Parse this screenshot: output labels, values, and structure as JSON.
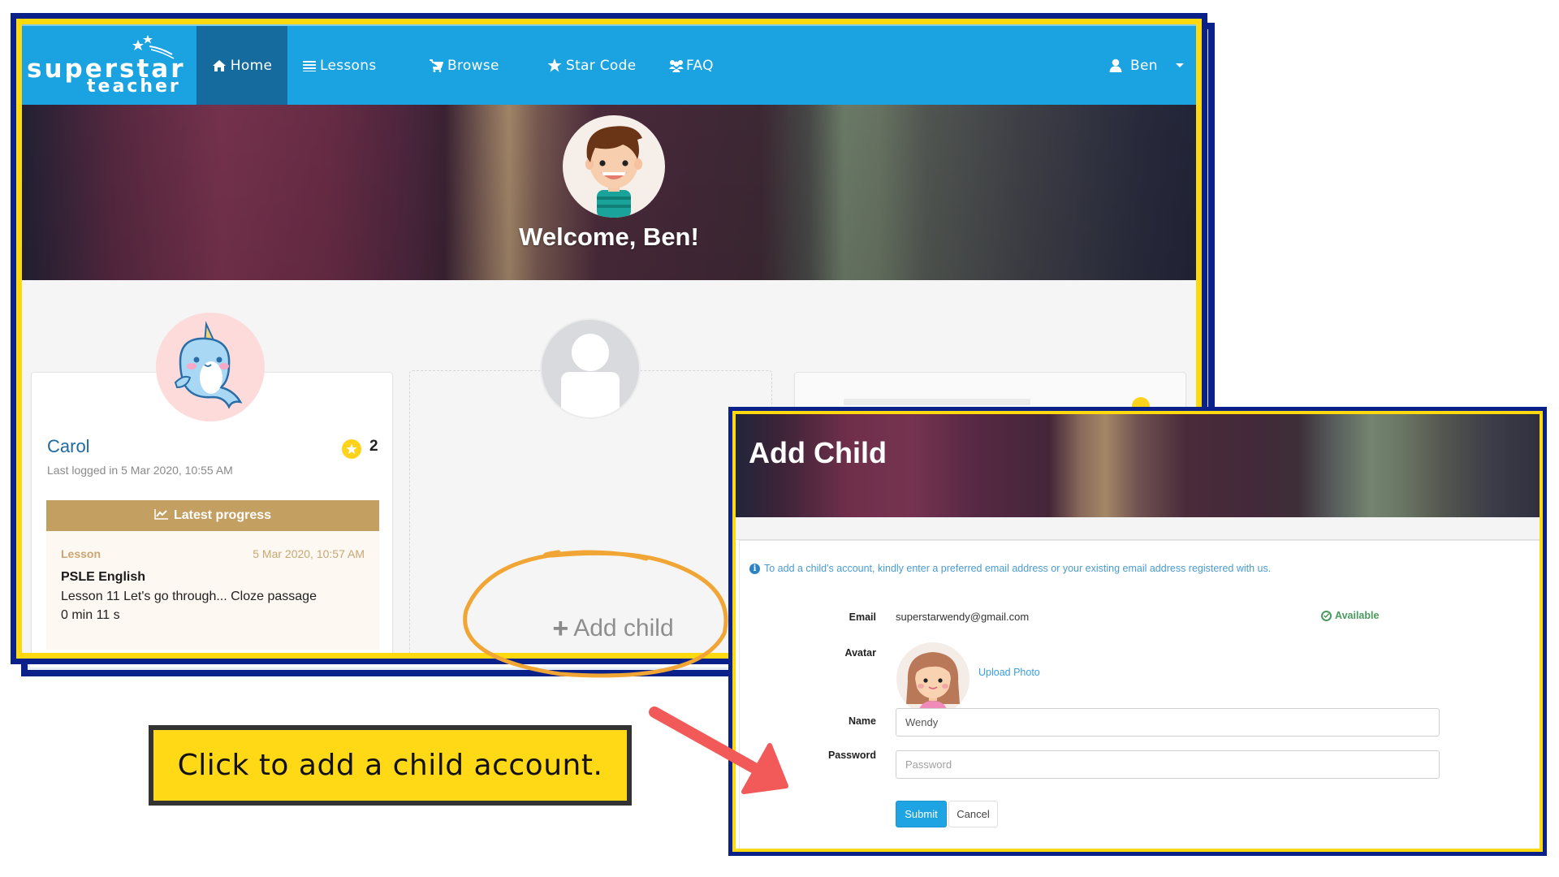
{
  "nav": {
    "logo_line1": "superstar",
    "logo_line2": "teacher",
    "items": [
      {
        "label": "Home",
        "icon": "home-icon",
        "active": true
      },
      {
        "label": "Lessons",
        "icon": "list-icon",
        "active": false
      },
      {
        "label": "Browse",
        "icon": "cart-icon",
        "active": false
      },
      {
        "label": "Star Code",
        "icon": "star-icon",
        "active": false
      },
      {
        "label": "FAQ",
        "icon": "users-icon",
        "active": false
      }
    ],
    "user": {
      "name": "Ben",
      "icon": "user-icon"
    }
  },
  "banner": {
    "welcome": "Welcome, Ben!"
  },
  "children": [
    {
      "name": "Carol",
      "last_logged": "Last logged in 5 Mar 2020, 10:55 AM",
      "stars": "2",
      "progress": {
        "header": "Latest progress",
        "type": "Lesson",
        "date": "5 Mar 2020, 10:57 AM",
        "course": "PSLE English",
        "lesson": "Lesson 11 Let's go through... Cloze passage",
        "time_spent": "0 min 11 s"
      }
    }
  ],
  "add_child": {
    "label": "Add child",
    "icon": "plus-icon"
  },
  "modal": {
    "title": "Add Child",
    "info": "To add a child's account, kindly enter a preferred email address or your existing email address registered with us.",
    "email_label": "Email",
    "email_value": "superstarwendy@gmail.com",
    "email_status": "Available",
    "avatar_label": "Avatar",
    "upload_label": "Upload Photo",
    "name_label": "Name",
    "name_value": "Wendy",
    "password_label": "Password",
    "password_placeholder": "Password",
    "submit_label": "Submit",
    "cancel_label": "Cancel"
  },
  "callout": {
    "text": "Click to add a child account."
  },
  "colors": {
    "nav": "#1ba3e1",
    "nav_active": "#156a9e",
    "frame_border": "#0a2189",
    "frame_highlight": "#ffd90f",
    "progress_header": "#c49f62",
    "annotation_ring": "#f0a534",
    "arrow": "#f25a5a",
    "callout_bg": "#ffd916"
  }
}
